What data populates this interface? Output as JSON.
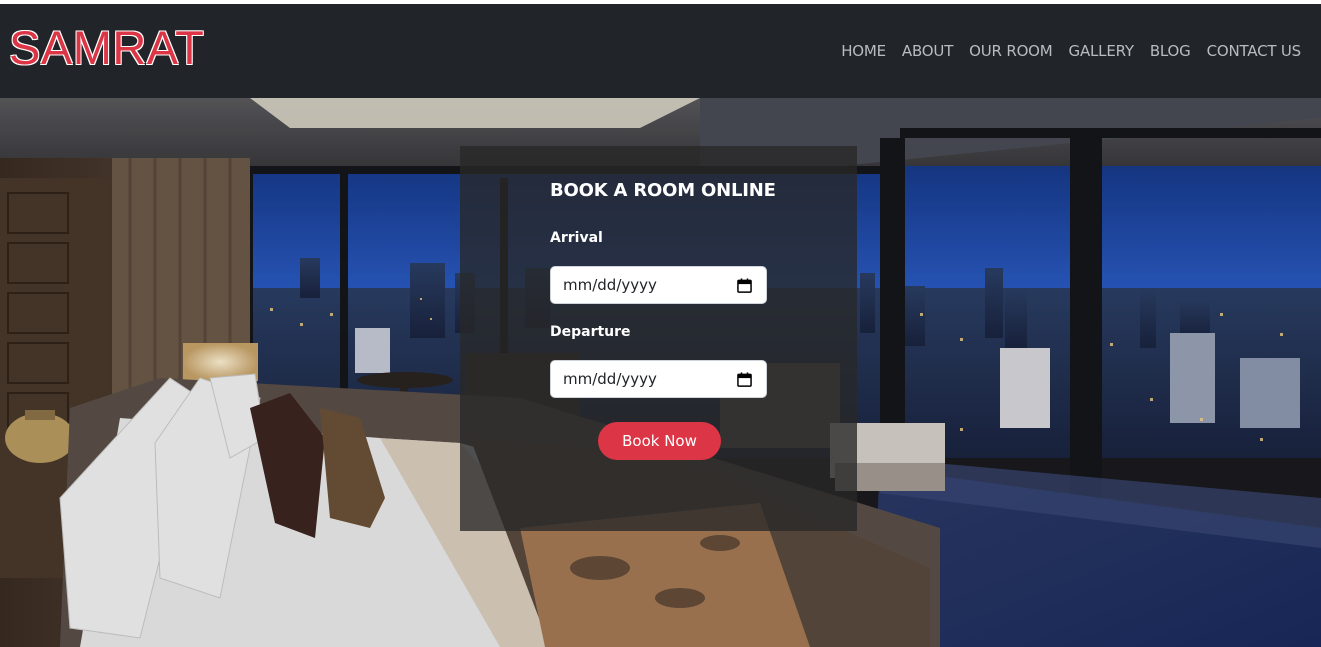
{
  "brand": {
    "name": "SAMRAT",
    "color": "#dc3545"
  },
  "nav": {
    "items": [
      "HOME",
      "ABOUT",
      "OUR ROOM",
      "GALLERY",
      "BLOG",
      "CONTACT US"
    ]
  },
  "booking": {
    "title": "BOOK A ROOM ONLINE",
    "arrival_label": "Arrival",
    "arrival_value": "mm/dd/yyyy",
    "departure_label": "Departure",
    "departure_value": "mm/dd/yyyy",
    "button_label": "Book Now",
    "button_color": "#dc3545"
  },
  "hero": {
    "image": "hotel-room-night-city-view"
  },
  "icons": {
    "calendar": "calendar-icon"
  }
}
